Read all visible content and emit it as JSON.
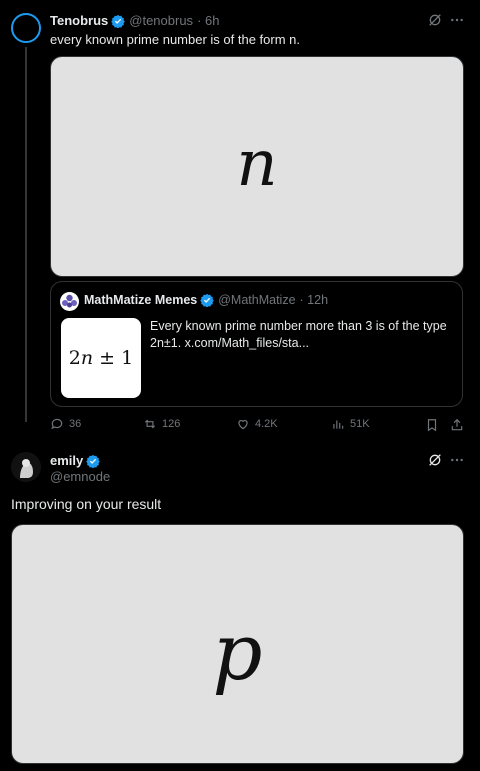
{
  "tweet1": {
    "name": "Tenobrus",
    "handle": "@tenobrus",
    "time": "· 6h",
    "text": "every known prime number is of the form n.",
    "media_symbol": "n"
  },
  "quote": {
    "name": "MathMatize Memes",
    "handle": "@MathMatize",
    "time": "· 12h",
    "text_line1": "Every known prime number more than 3 is of the type",
    "text_line2": "2n±1.  x.com/Math_files/sta...",
    "thumb_a": "2",
    "thumb_n": "n",
    "thumb_rest": " ± 1"
  },
  "actions": {
    "replies": "36",
    "reposts": "126",
    "likes": "4.2K",
    "views": "51K"
  },
  "tweet2": {
    "name": "emily",
    "handle": "@emnode",
    "text": "Improving on your result",
    "media_symbol": "p"
  },
  "colors": {
    "accent": "#1d9bf0",
    "muted": "#71767b",
    "border": "#2f3336",
    "background": "#000000"
  }
}
